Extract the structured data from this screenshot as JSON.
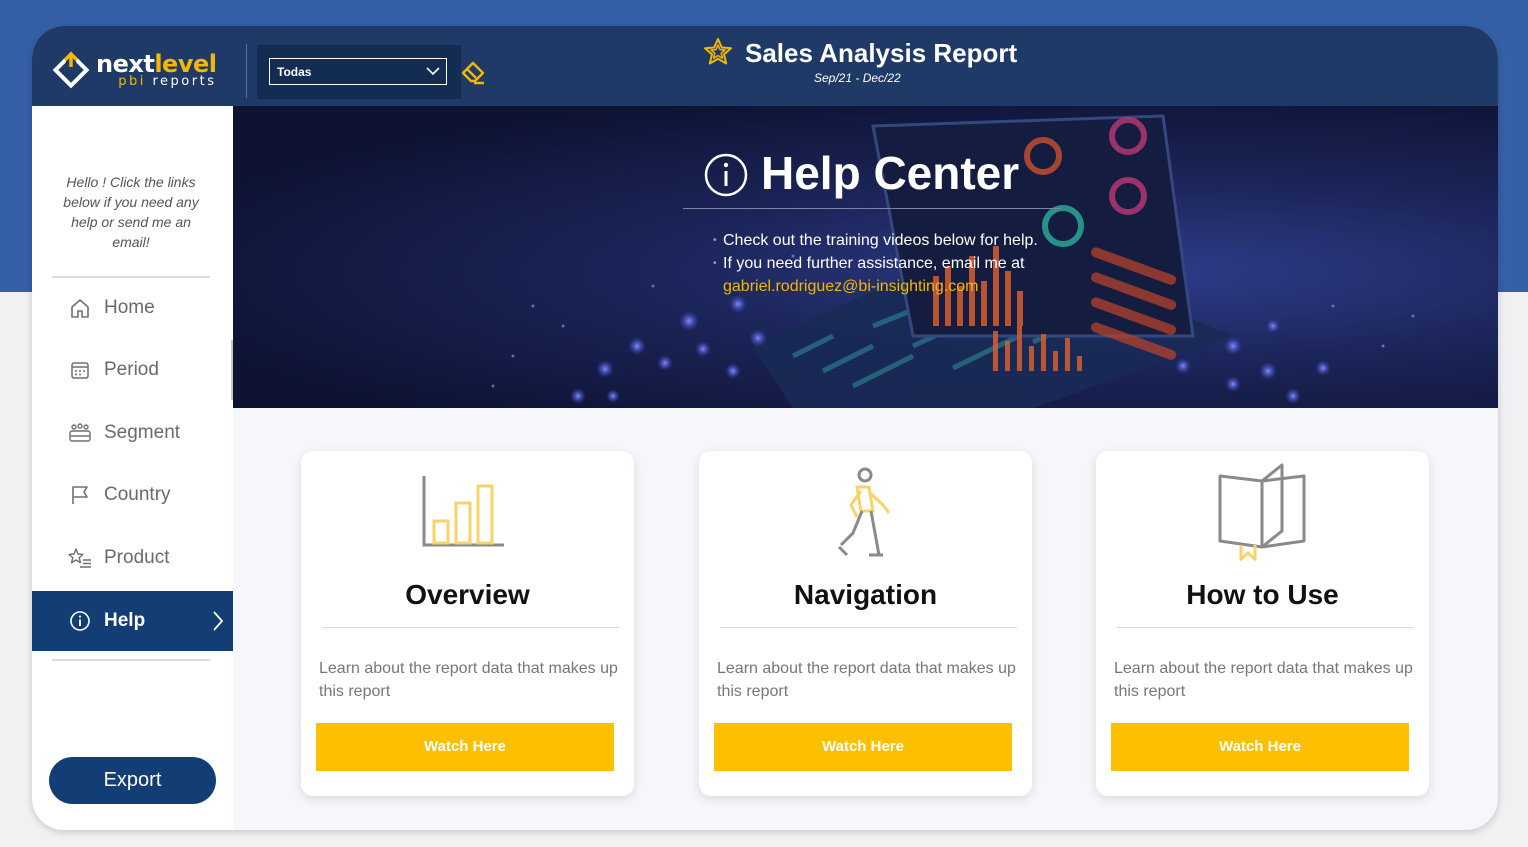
{
  "brand": {
    "logo_main_part1": "next",
    "logo_main_part2": "level",
    "logo_sub_part1": "pbi",
    "logo_sub_part2": " reports"
  },
  "filter": {
    "selected": "Todas"
  },
  "header": {
    "title": "Sales Analysis Report",
    "subtitle": "Sep/21 - Dec/22"
  },
  "sidebar": {
    "message": "Hello ! Click the links below if you need any help or send me an email!",
    "items": [
      {
        "label": "Home",
        "icon": "home-icon"
      },
      {
        "label": "Period",
        "icon": "calendar-icon"
      },
      {
        "label": "Segment",
        "icon": "people-group-icon"
      },
      {
        "label": "Country",
        "icon": "flag-icon"
      },
      {
        "label": "Product",
        "icon": "star-list-icon"
      },
      {
        "label": "Help",
        "icon": "info-icon",
        "active": true
      }
    ],
    "export_label": "Export"
  },
  "hero": {
    "title": "Help Center",
    "line1": "Check out the training videos below for help.",
    "line2": "If you need further assistance, email me at",
    "email": "gabriel.rodriguez@bi-insighting.com"
  },
  "cards": [
    {
      "title": "Overview",
      "description": "Learn about the report data that makes up this report",
      "button": "Watch Here",
      "icon": "bar-chart-icon"
    },
    {
      "title": "Navigation",
      "description": "Learn about the report data that makes up this report",
      "button": "Watch Here",
      "icon": "walking-person-icon"
    },
    {
      "title": "How to Use",
      "description": "Learn about the report data that makes up this report",
      "button": "Watch Here",
      "icon": "open-book-icon"
    }
  ],
  "colors": {
    "primary_navy": "#123e75",
    "header_bar": "#1f3a66",
    "accent_yellow": "#fcc000",
    "page_band_blue": "#3560a8"
  }
}
